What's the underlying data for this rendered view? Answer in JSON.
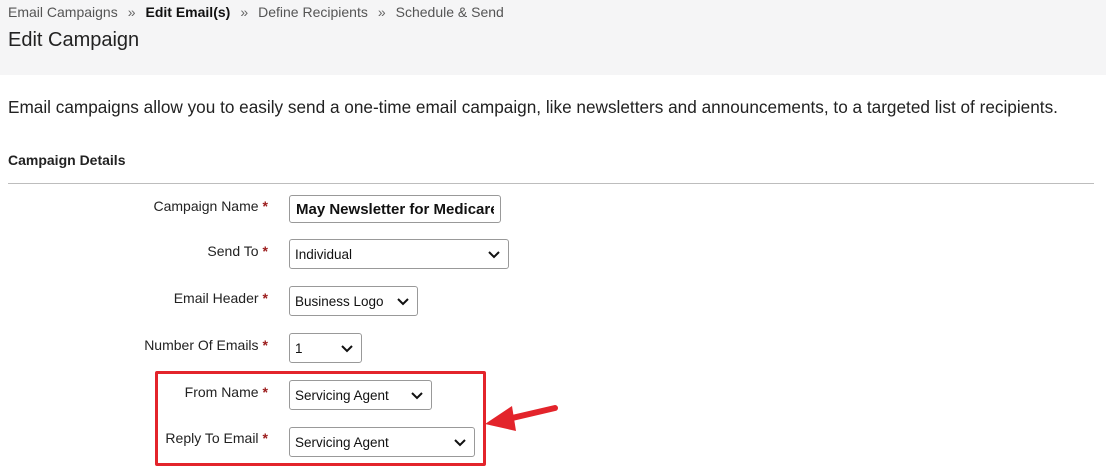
{
  "breadcrumb": {
    "items": [
      "Email Campaigns",
      "Edit Email(s)",
      "Define Recipients",
      "Schedule & Send"
    ],
    "separator": "»",
    "current_index": 1
  },
  "page_title": "Edit Campaign",
  "intro_text": "Email campaigns allow you to easily send a one-time email campaign, like newsletters and announcements, to a targeted list of recipients.",
  "section": {
    "heading": "Campaign Details"
  },
  "required_marker": "*",
  "fields": {
    "campaign_name": {
      "label": "Campaign Name",
      "value": "May Newsletter for Medicare"
    },
    "send_to": {
      "label": "Send To",
      "value": "Individual"
    },
    "email_header": {
      "label": "Email Header",
      "value": "Business Logo"
    },
    "number_of_emails": {
      "label": "Number Of Emails",
      "value": "1"
    },
    "from_name": {
      "label": "From Name",
      "value": "Servicing Agent"
    },
    "reply_to_email": {
      "label": "Reply To Email",
      "value": "Servicing Agent"
    }
  },
  "colors": {
    "required": "#9b1b1b",
    "annotation": "#e3242b",
    "header_band": "#f5f5f6"
  },
  "icons": {
    "select_arrow": "chevron-down-icon",
    "annotation_arrow": "red-arrow-icon"
  }
}
